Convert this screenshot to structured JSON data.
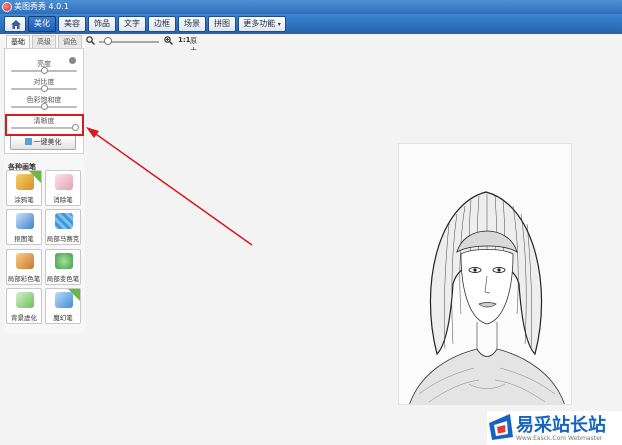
{
  "app": {
    "title": "美图秀秀 4.0.1"
  },
  "main_tabs": [
    "美化",
    "美容",
    "饰品",
    "文字",
    "边框",
    "场景",
    "拼图",
    "更多功能"
  ],
  "main_tab_active": "美化",
  "sub_tabs": [
    "基础",
    "高级",
    "调色"
  ],
  "sub_tab_active": "基础",
  "sliders": [
    {
      "label": "亮度",
      "value": 0.5
    },
    {
      "label": "对比度",
      "value": 0.5
    },
    {
      "label": "色彩饱和度",
      "value": 0.5
    },
    {
      "label": "清晰度",
      "value": 0.97
    }
  ],
  "one_key_button": "一键美化",
  "brushes": {
    "title": "各种画笔",
    "tools": [
      {
        "label": "涂鸦笔",
        "icon": "pencil-icon",
        "color": "#e8b23a"
      },
      {
        "label": "消除笔",
        "icon": "eraser-icon",
        "color": "#e7a7b8"
      },
      {
        "label": "抠图笔",
        "icon": "cutout-icon",
        "color": "#4c8fd6"
      },
      {
        "label": "局部马赛克",
        "icon": "mosaic-icon",
        "color": "#56a7e6"
      },
      {
        "label": "局部彩色笔",
        "icon": "color-brush-icon",
        "color": "#d88b3a"
      },
      {
        "label": "局部变色笔",
        "icon": "recolor-icon",
        "color": "#4fb05a"
      },
      {
        "label": "背景虚化",
        "icon": "blur-icon",
        "color": "#6bbf59"
      },
      {
        "label": "魔幻笔",
        "icon": "magic-pen-icon",
        "color": "#3e8ed8"
      }
    ]
  },
  "zoom": {
    "actual_size_label": "1:1",
    "original_label": "原大",
    "value": 0.15
  },
  "watermark": {
    "title": "易采站长站",
    "url": "Www.Easck.Com Webmaster"
  },
  "colors": {
    "accent": "#2f6fb8",
    "highlight": "#d9181f"
  }
}
